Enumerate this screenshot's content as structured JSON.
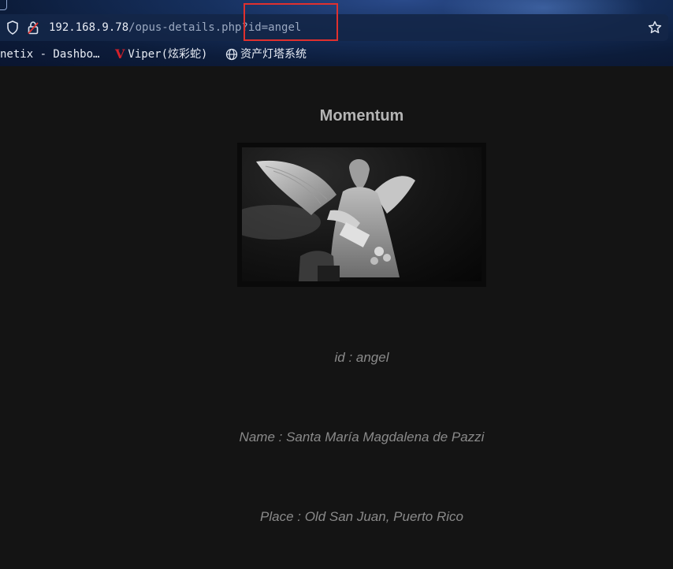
{
  "browser": {
    "url_host": "192.168.9.78",
    "url_path": "/opus-details.php?id=angel",
    "bookmarks": [
      {
        "label": "netix - Dashbo…",
        "icon": ""
      },
      {
        "label": "Viper(炫彩蛇)",
        "icon": "viper-v-icon"
      },
      {
        "label": "资产灯塔系统",
        "icon": "globe-icon"
      }
    ],
    "highlight_color": "#e0302e"
  },
  "page": {
    "title": "Momentum",
    "image_alt": "angel statue",
    "fields": {
      "id": "id : angel",
      "name": "Name : Santa María Magdalena de Pazzi",
      "place": "Place : Old San Juan, Puerto Rico"
    }
  }
}
